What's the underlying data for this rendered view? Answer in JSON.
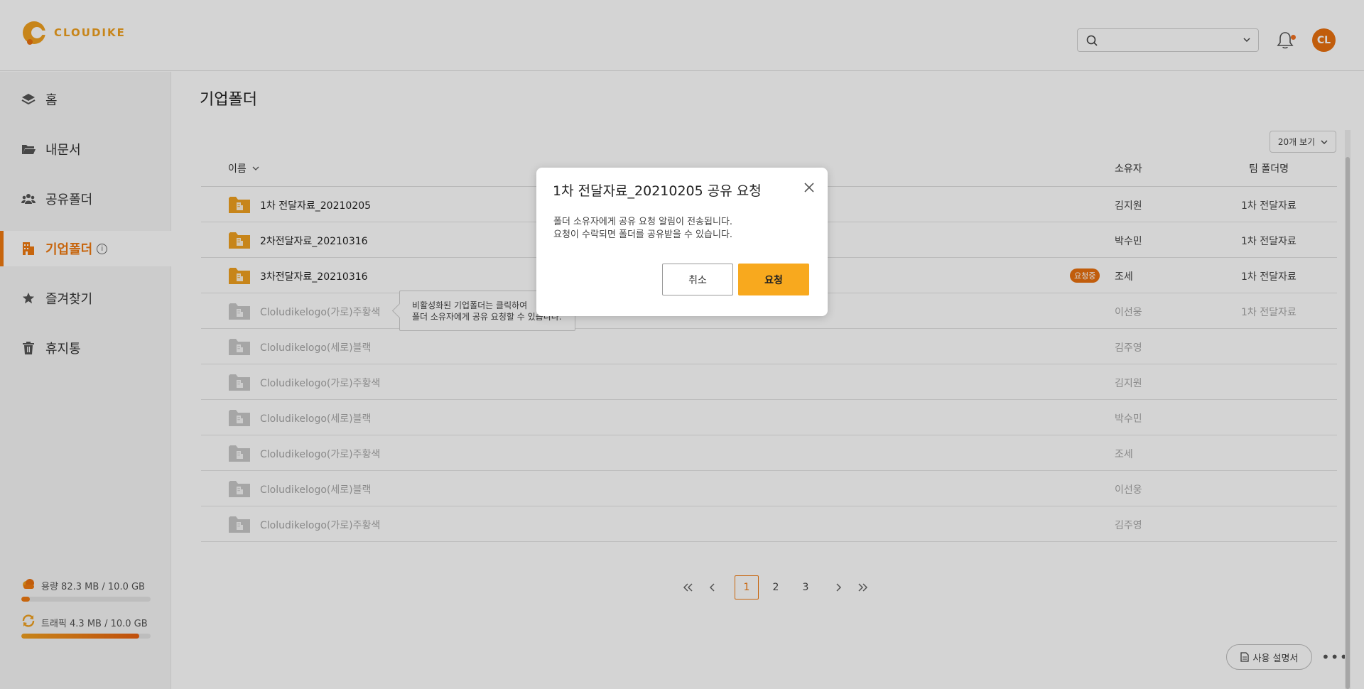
{
  "header": {
    "logo_text": "CLOUDIKE",
    "search": {
      "placeholder": ""
    },
    "avatar_initials": "CL"
  },
  "sidebar": {
    "items": [
      {
        "label": "홈",
        "icon": "layers-icon"
      },
      {
        "label": "내문서",
        "icon": "folder-open-icon"
      },
      {
        "label": "공유폴더",
        "icon": "users-icon"
      },
      {
        "label": "기업폴더",
        "icon": "building-icon",
        "active": true
      },
      {
        "label": "즐겨찾기",
        "icon": "star-icon"
      },
      {
        "label": "휴지통",
        "icon": "trash-icon"
      }
    ],
    "usage": [
      {
        "label": "용량 82.3 MB / 10.0 GB",
        "icon": "cloud-icon",
        "fraction": 0.008
      },
      {
        "label": "트래픽 4.3 MB / 10.0 GB",
        "icon": "sync-icon",
        "fraction": 0.92
      }
    ]
  },
  "main": {
    "title": "기업폴더",
    "view_select": "20개 보기",
    "columns": {
      "name": "이름",
      "owner": "소유자",
      "team": "팀 폴더명"
    },
    "rows": [
      {
        "name": "1차 전달자료_20210205",
        "owner": "김지원",
        "team": "1차 전달자료",
        "disabled": false,
        "badge": ""
      },
      {
        "name": "2차전달자료_20210316",
        "owner": "박수민",
        "team": "1차 전달자료",
        "disabled": false,
        "badge": ""
      },
      {
        "name": "3차전달자료_20210316",
        "owner": "조세",
        "team": "1차 전달자료",
        "disabled": false,
        "badge": "요청중"
      },
      {
        "name": "Cloludikelogo(가로)주황색",
        "owner": "이선웅",
        "team": "1차 전달자료",
        "disabled": true,
        "badge": ""
      },
      {
        "name": "Cloludikelogo(세로)블랙",
        "owner": "김주영",
        "team": "",
        "disabled": true,
        "badge": ""
      },
      {
        "name": "Cloludikelogo(가로)주황색",
        "owner": "김지원",
        "team": "",
        "disabled": true,
        "badge": ""
      },
      {
        "name": "Cloludikelogo(세로)블랙",
        "owner": "박수민",
        "team": "",
        "disabled": true,
        "badge": ""
      },
      {
        "name": "Cloludikelogo(가로)주황색",
        "owner": "조세",
        "team": "",
        "disabled": true,
        "badge": ""
      },
      {
        "name": "Cloludikelogo(세로)블랙",
        "owner": "이선웅",
        "team": "",
        "disabled": true,
        "badge": ""
      },
      {
        "name": "Cloludikelogo(가로)주황색",
        "owner": "김주영",
        "team": "",
        "disabled": true,
        "badge": ""
      }
    ],
    "tooltip": {
      "line1": "비활성화된 기업폴더는 클릭하여",
      "line2": "폴더 소유자에게 공유 요청할 수 있습니다."
    },
    "pagination": {
      "pages": [
        "1",
        "2",
        "3"
      ],
      "current": "1"
    },
    "manual_button": "사용 설명서",
    "more_button": "•••"
  },
  "dialog": {
    "title": "1차 전달자료_20210205 공유 요청",
    "message_line1": "폴더 소유자에게 공유 요청 알림이 전송됩니다.",
    "message_line2": "요청이 수락되면 폴더를 공유받을 수 있습니다.",
    "cancel_label": "취소",
    "confirm_label": "요청"
  },
  "colors": {
    "accent": "#f07a10",
    "folder_active": "#f0a020",
    "folder_disabled": "#c8c8c8",
    "confirm_button": "#f8a91e"
  }
}
